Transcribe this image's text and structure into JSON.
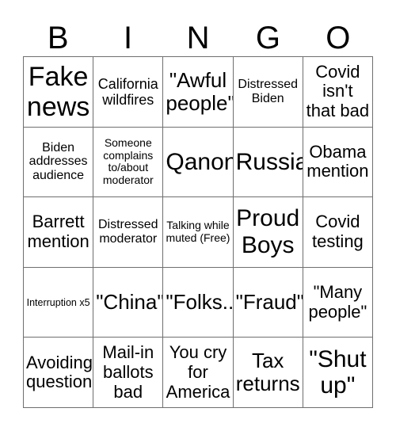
{
  "header": {
    "letters": [
      "B",
      "I",
      "N",
      "G",
      "O"
    ]
  },
  "grid": {
    "columns": 5,
    "rows": 5,
    "cells": [
      {
        "text": "Fake news",
        "size": "fs-xxl"
      },
      {
        "text": "California wildfires",
        "size": "fs-sm"
      },
      {
        "text": "\"Awful people\"",
        "size": "fs-lg"
      },
      {
        "text": "Distressed Biden",
        "size": "fs-xs"
      },
      {
        "text": "Covid isn't that bad",
        "size": "fs-md"
      },
      {
        "text": "Biden addresses audience",
        "size": "fs-xs"
      },
      {
        "text": "Someone complains to/about moderator",
        "size": "fs-xxs"
      },
      {
        "text": "Qanon",
        "size": "fs-xl"
      },
      {
        "text": "Russia",
        "size": "fs-xl"
      },
      {
        "text": "Obama mention",
        "size": "fs-md"
      },
      {
        "text": "Barrett mention",
        "size": "fs-md"
      },
      {
        "text": "Distressed moderator",
        "size": "fs-xs"
      },
      {
        "text": "Talking while muted (Free)",
        "size": "fs-xxs"
      },
      {
        "text": "Proud Boys",
        "size": "fs-xl"
      },
      {
        "text": "Covid testing",
        "size": "fs-md"
      },
      {
        "text": "Interruption x5",
        "size": "fs-tiny"
      },
      {
        "text": "\"China\"",
        "size": "fs-lg"
      },
      {
        "text": "\"Folks..\"",
        "size": "fs-lg"
      },
      {
        "text": "\"Fraud\"",
        "size": "fs-lg"
      },
      {
        "text": "\"Many people\"",
        "size": "fs-md"
      },
      {
        "text": "Avoiding question",
        "size": "fs-md"
      },
      {
        "text": "Mail-in ballots bad",
        "size": "fs-md"
      },
      {
        "text": "You cry for America",
        "size": "fs-md"
      },
      {
        "text": "Tax returns",
        "size": "fs-lg"
      },
      {
        "text": "\"Shut up\"",
        "size": "fs-xl"
      }
    ]
  },
  "colors": {
    "background": "#ffffff",
    "text": "#000000",
    "gridline": "#6f6f6f"
  }
}
